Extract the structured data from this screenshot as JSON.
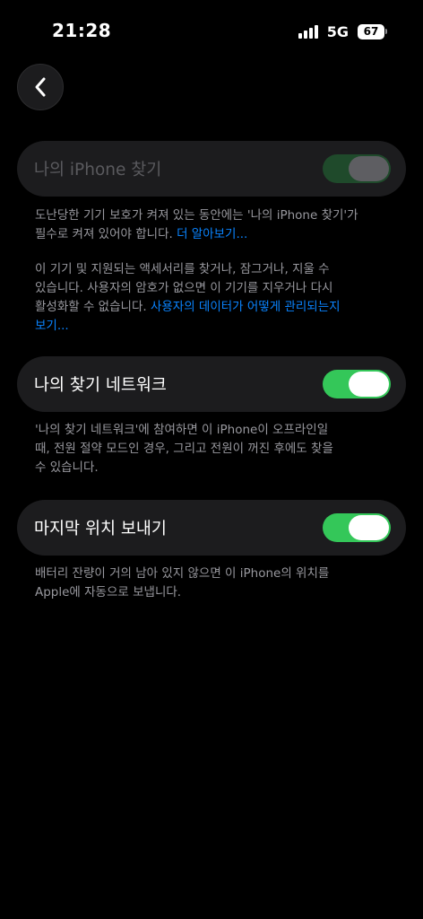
{
  "status_bar": {
    "time": "21:28",
    "network": "5G",
    "battery": "67"
  },
  "back_button": {
    "icon": "chevron-left-icon"
  },
  "find_my_iphone": {
    "label": "나의 iPhone 찾기",
    "enabled": true,
    "disabled": true,
    "desc1_line1": "도난당한 기기 보호가 켜져 있는 동안에는 '나의 iPhone 찾기'가",
    "desc1_line2_text": "필수로 켜져 있어야 합니다. ",
    "desc1_link": "더 알아보기...",
    "desc2_line1": "이 기기 및 지원되는 액세서리를 찾거나, 잠그거나, 지울 수",
    "desc2_line2": "있습니다. 사용자의 암호가 없으면 이 기기를 지우거나 다시",
    "desc2_line3_text": "활성화할 수 없습니다. ",
    "desc2_link_part1": "사용자의 데이터가 어떻게 관리되는지",
    "desc2_link_part2": "보기..."
  },
  "find_my_network": {
    "label": "나의 찾기 네트워크",
    "enabled": true,
    "desc_line1": "'나의 찾기 네트워크'에 참여하면 이 iPhone이 오프라인일",
    "desc_line2": "때, 전원 절약 모드인 경우, 그리고 전원이 꺼진 후에도 찾을",
    "desc_line3": "수 있습니다."
  },
  "send_last_location": {
    "label": "마지막 위치 보내기",
    "enabled": true,
    "desc_line1": "배터리 잔량이 거의 남아 있지 않으면 이 iPhone의 위치를",
    "desc_line2": "Apple에 자동으로 보냅니다."
  },
  "colors": {
    "background": "#000000",
    "card": "#1c1c1e",
    "toggle_on": "#34c759",
    "link": "#0a84ff",
    "secondary_text": "#98989e"
  }
}
